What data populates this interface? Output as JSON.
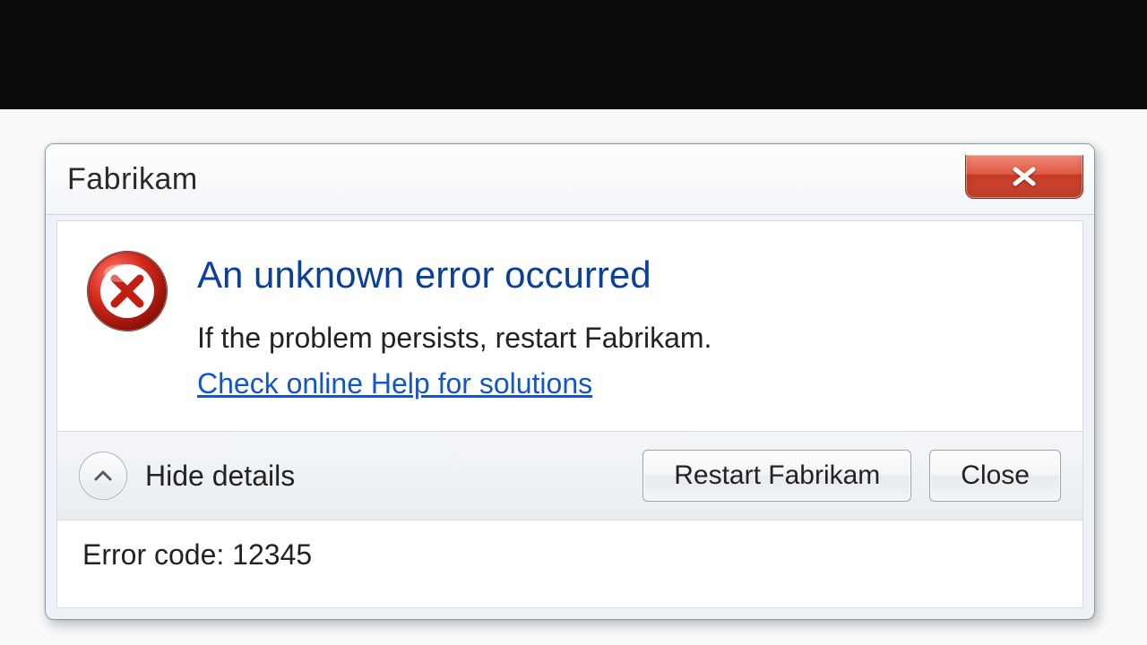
{
  "window": {
    "title": "Fabrikam"
  },
  "dialog": {
    "headline": "An unknown error occurred",
    "body": "If the problem persists, restart Fabrikam.",
    "help_link": "Check online Help for solutions"
  },
  "footer": {
    "toggle_label": "Hide details",
    "restart_label": "Restart Fabrikam",
    "close_label": "Close"
  },
  "details": {
    "error_code_label": "Error code: 12345"
  },
  "colors": {
    "headline": "#0a3f9a",
    "link": "#1456c7",
    "close_btn": "#d84a33"
  }
}
